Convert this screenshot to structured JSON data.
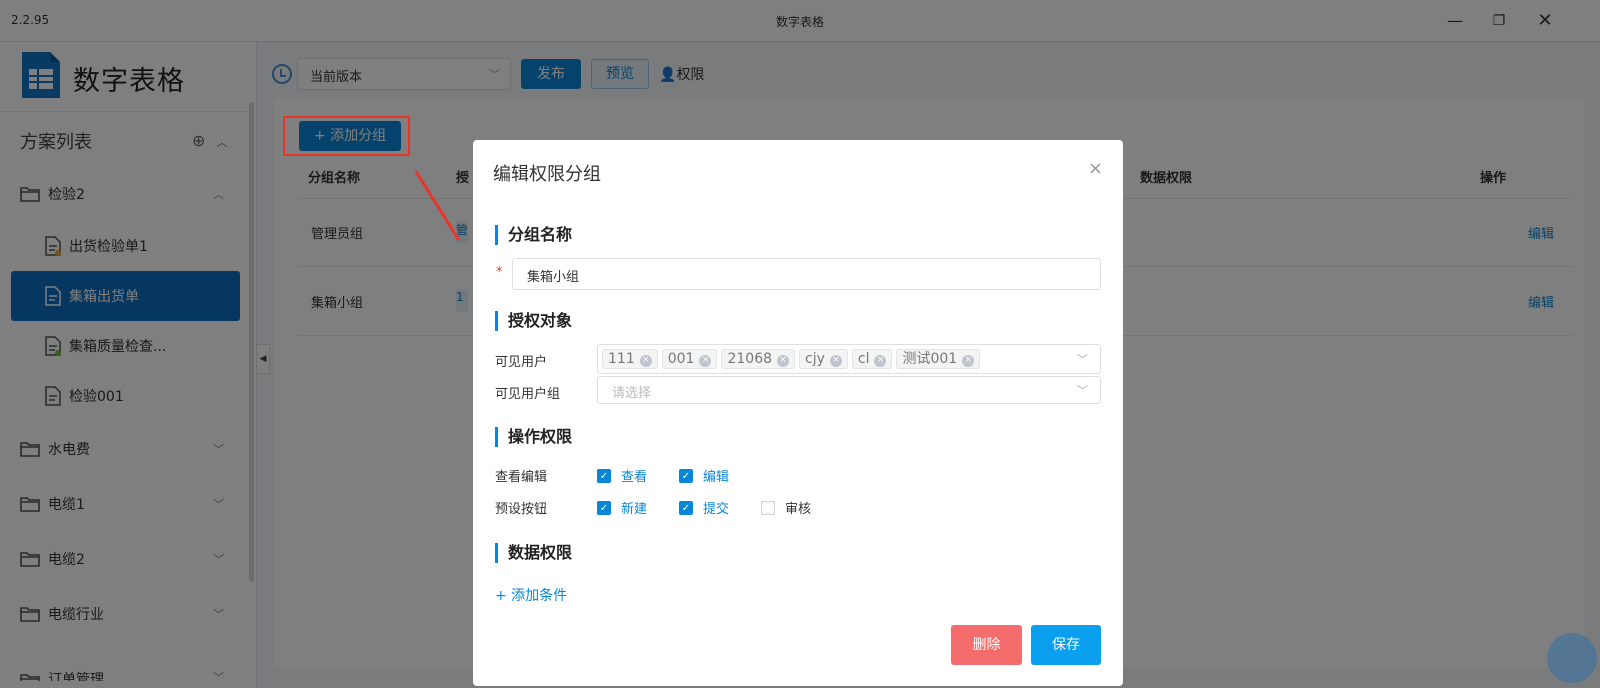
{
  "window": {
    "version": "2.2.95",
    "title": "数字表格",
    "min_icon": "minimize-icon",
    "restore_icon": "restore-icon",
    "close_icon": "close-icon"
  },
  "app": {
    "brand": "数字表格",
    "logo_icon": "table-logo-icon"
  },
  "sidebar": {
    "header": "方案列表",
    "items": [
      {
        "label": "检验2",
        "type": "folder",
        "expanded": true
      },
      {
        "label": "出货检验单1",
        "type": "leaf",
        "dot": "#e6a23c"
      },
      {
        "label": "集箱出货单",
        "type": "leaf",
        "active": true
      },
      {
        "label": "集箱质量检查...",
        "type": "leaf",
        "dot": "#67c23a"
      },
      {
        "label": "检验001",
        "type": "leaf"
      },
      {
        "label": "水电费",
        "type": "folder"
      },
      {
        "label": "电缆1",
        "type": "folder"
      },
      {
        "label": "电缆2",
        "type": "folder"
      },
      {
        "label": "电缆行业",
        "type": "folder"
      },
      {
        "label": "订单管理",
        "type": "folder"
      }
    ]
  },
  "toolbar": {
    "version_select": "当前版本",
    "publish": "发布",
    "preview": "预览",
    "permission": "权限"
  },
  "content": {
    "add_group": "+ 添加分组",
    "columns": {
      "name": "分组名称",
      "auth": "授",
      "data_perm": "数据权限",
      "ops": "操作"
    },
    "rows": [
      {
        "name": "管理员组",
        "tag": "管",
        "edit": "编辑"
      },
      {
        "name": "集箱小组",
        "tag": "1",
        "edit": "编辑"
      }
    ]
  },
  "dialog": {
    "title": "编辑权限分组",
    "sections": {
      "group_name": "分组名称",
      "auth_target": "授权对象",
      "op_perm": "操作权限",
      "data_perm": "数据权限"
    },
    "group_name_value": "集箱小组",
    "visible_users_label": "可见用户",
    "visible_users": [
      "111",
      "001",
      "21068",
      "cjy",
      "cl",
      "测试001"
    ],
    "visible_groups_label": "可见用户组",
    "visible_groups_placeholder": "请选择",
    "view_edit_label": "查看编辑",
    "view_edit": [
      {
        "label": "查看",
        "checked": true
      },
      {
        "label": "编辑",
        "checked": true
      }
    ],
    "preset_label": "预设按钮",
    "preset": [
      {
        "label": "新建",
        "checked": true
      },
      {
        "label": "提交",
        "checked": true
      },
      {
        "label": "审核",
        "checked": false
      }
    ],
    "add_condition": "+ 添加条件",
    "delete": "删除",
    "save": "保存"
  }
}
